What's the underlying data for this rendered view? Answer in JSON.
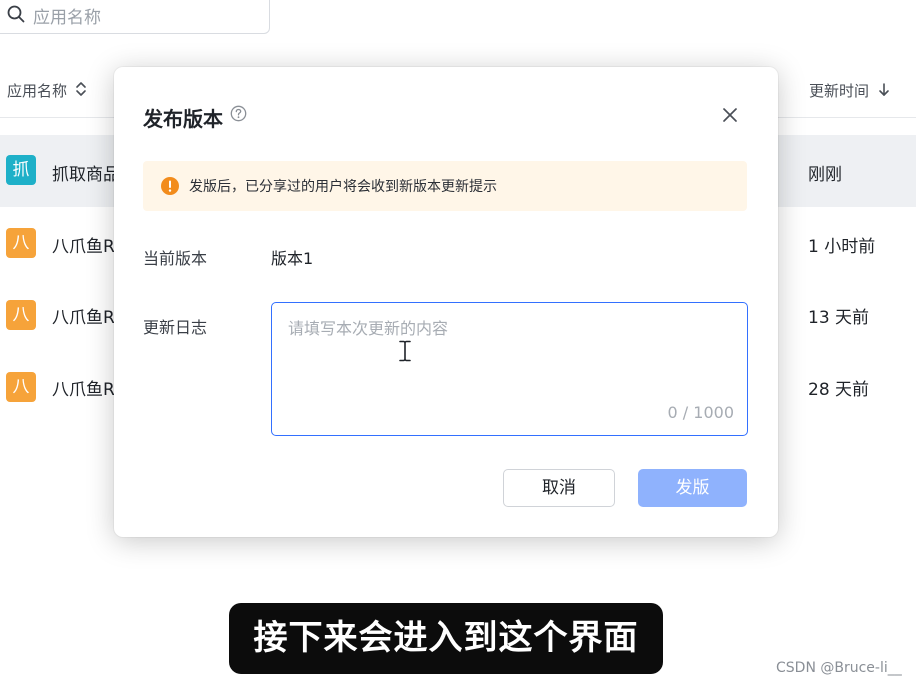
{
  "search": {
    "placeholder": "应用名称"
  },
  "table": {
    "columns": {
      "name": "应用名称",
      "updated": "更新时间"
    },
    "rows": [
      {
        "badge": "抓",
        "name": "抓取商品",
        "updated": "刚刚",
        "badge_color": "#1eb0c8"
      },
      {
        "badge": "八",
        "name": "八爪鱼R",
        "updated": "1 小时前",
        "badge_color": "#f6a33a"
      },
      {
        "badge": "八",
        "name": "八爪鱼R",
        "updated": "13 天前",
        "badge_color": "#f6a33a"
      },
      {
        "badge": "八",
        "name": "八爪鱼R",
        "updated": "28 天前",
        "badge_color": "#f6a33a"
      }
    ]
  },
  "dialog": {
    "title": "发布版本",
    "alert": "发版后，已分享过的用户将会收到新版本更新提示",
    "current_version_label": "当前版本",
    "current_version_value": "版本1",
    "changelog_label": "更新日志",
    "changelog_placeholder": "请填写本次更新的内容",
    "changelog_value": "",
    "counter": "0 / 1000",
    "cancel_label": "取消",
    "publish_label": "发版"
  },
  "caption": "接下来会进入到这个界面",
  "watermark": "CSDN @Bruce-li__",
  "colors": {
    "accent": "#3370ff",
    "publish_disabled": "#8fb2fd",
    "alert_bg": "#fff6e8",
    "alert_icon": "#f28c1c"
  }
}
